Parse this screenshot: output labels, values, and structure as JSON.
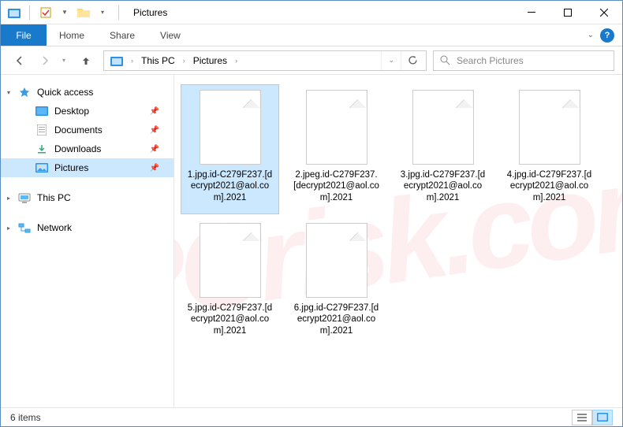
{
  "titlebar": {
    "title": "Pictures"
  },
  "ribbon": {
    "file": "File",
    "tabs": [
      "Home",
      "Share",
      "View"
    ]
  },
  "breadcrumb": {
    "segments": [
      "This PC",
      "Pictures"
    ]
  },
  "search": {
    "placeholder": "Search Pictures"
  },
  "sidebar": {
    "quick_access": "Quick access",
    "items": [
      {
        "label": "Desktop",
        "pinned": true
      },
      {
        "label": "Documents",
        "pinned": true
      },
      {
        "label": "Downloads",
        "pinned": true
      },
      {
        "label": "Pictures",
        "pinned": true,
        "selected": true
      }
    ],
    "this_pc": "This PC",
    "network": "Network"
  },
  "files": [
    {
      "name": "1.jpg.id-C279F237.[decrypt2021@aol.com].2021",
      "selected": true
    },
    {
      "name": "2.jpeg.id-C279F237.[decrypt2021@aol.com].2021"
    },
    {
      "name": "3.jpg.id-C279F237.[decrypt2021@aol.com].2021"
    },
    {
      "name": "4.jpg.id-C279F237.[decrypt2021@aol.com].2021"
    },
    {
      "name": "5.jpg.id-C279F237.[decrypt2021@aol.com].2021"
    },
    {
      "name": "6.jpg.id-C279F237.[decrypt2021@aol.com].2021"
    }
  ],
  "statusbar": {
    "count": "6 items"
  },
  "watermark": "PCrisk.com"
}
